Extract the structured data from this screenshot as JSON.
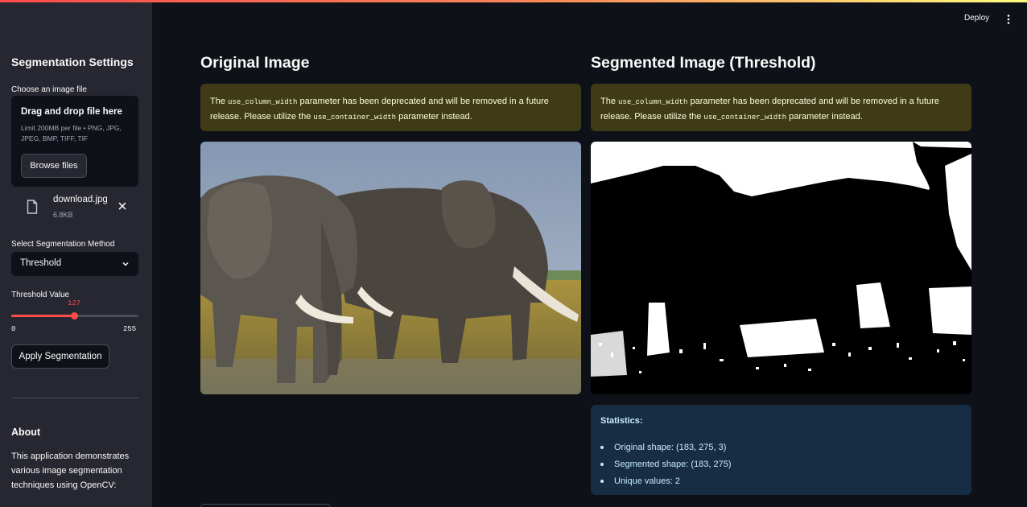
{
  "colors": {
    "accent": "#ff4b4b",
    "sidebar_bg": "#262730",
    "main_bg": "#0e1117",
    "warning_bg": "#3e3b16",
    "info_bg": "#172d43"
  },
  "header": {
    "deploy_label": "Deploy",
    "menu_icon": "vertical-dots-icon"
  },
  "sidebar": {
    "title": "Segmentation Settings",
    "uploader": {
      "label": "Choose an image file",
      "dropzone_title": "Drag and drop file here",
      "limit_text": "Limit 200MB per file • PNG, JPG, JPEG, BMP, TIFF, TIF",
      "browse_label": "Browse files",
      "file": {
        "name": "download.jpg",
        "size": "6.8KB",
        "icon": "file-icon",
        "remove_icon": "close-icon"
      }
    },
    "method": {
      "label": "Select Segmentation Method",
      "selected": "Threshold",
      "icon": "chevron-down-icon"
    },
    "threshold": {
      "label": "Threshold Value",
      "value": "127",
      "min": "0",
      "max": "255",
      "fraction": 0.498
    },
    "apply_label": "Apply Segmentation",
    "about": {
      "title": "About",
      "text": "This application demonstrates various image segmentation techniques using OpenCV:"
    }
  },
  "main": {
    "left": {
      "title": "Original Image",
      "warning": {
        "pre": "The ",
        "code1": "use_column_width",
        "mid": " parameter has been deprecated and will be removed in a future release. Please utilize the ",
        "code2": "use_container_width",
        "post": " parameter instead."
      },
      "image": "elephant-photo"
    },
    "right": {
      "title": "Segmented Image (Threshold)",
      "warning": {
        "pre": "The ",
        "code1": "use_column_width",
        "mid": " parameter has been deprecated and will be removed in a future release. Please utilize the ",
        "code2": "use_container_width",
        "post": " parameter instead."
      },
      "image": "segmented-binary-image",
      "stats": {
        "title": "Statistics:",
        "items": [
          "Original shape: (183, 275, 3)",
          "Segmented shape: (183, 275)",
          "Unique values: 2"
        ]
      }
    }
  }
}
